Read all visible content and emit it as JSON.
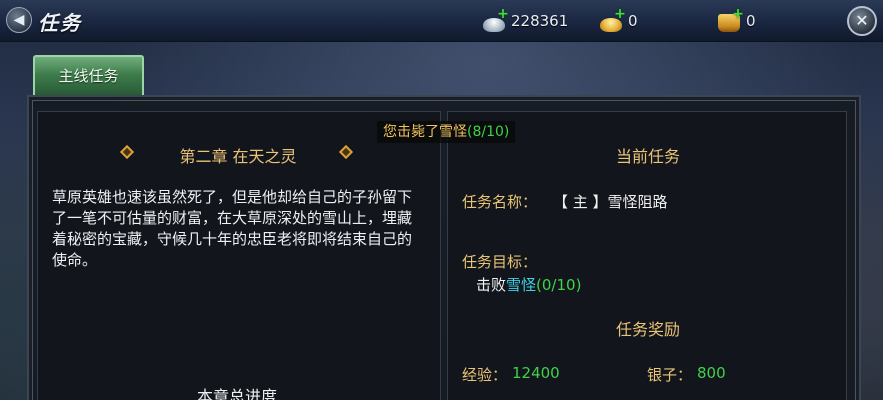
{
  "header": {
    "title": "任务",
    "currencies": [
      {
        "icon": "silver-ingot-icon",
        "value": "228361"
      },
      {
        "icon": "gold-ingot-icon",
        "value": "0"
      },
      {
        "icon": "gold-bag-icon",
        "value": "0"
      }
    ]
  },
  "tabs": [
    {
      "label": "主线任务"
    }
  ],
  "notice": {
    "text": "您击毙了雪怪",
    "count": "(8/10)"
  },
  "chapter": {
    "title": "第二章 在天之灵",
    "description": "草原英雄也速该虽然死了，但是他却给自己的子孙留下了一笔不可估量的财富，在大草原深处的雪山上，埋藏着秘密的宝藏，守候几十年的忠臣老将即将结束自己的使命。",
    "progress_label": "本章总进度"
  },
  "current_task": {
    "heading": "当前任务",
    "name_label": "任务名称：",
    "name_value": "【 主 】雪怪阻路",
    "goal_label": "任务目标：",
    "goal_prefix": "击败",
    "goal_target": "雪怪",
    "goal_progress": "(0/10)"
  },
  "rewards": {
    "heading": "任务奖励",
    "exp_label": "经验：",
    "exp_value": "12400",
    "silver_label": "银子：",
    "silver_value": "800"
  },
  "colors": {
    "gold_text": "#e9c477",
    "green_value": "#3fd24a",
    "cyan_target": "#3fd2e6",
    "tab_green": "#3f7d4d"
  }
}
